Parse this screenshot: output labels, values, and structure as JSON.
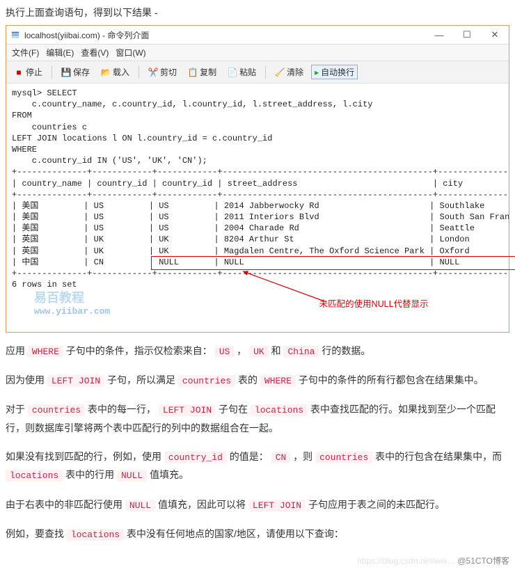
{
  "intro": "执行上面查询语句，得到以下结果 -",
  "window": {
    "title": "localhost(yiibai.com) - 命令列介面",
    "controls": {
      "min": "—",
      "max": "☐",
      "close": "✕"
    }
  },
  "menubar": {
    "file": "文件(F)",
    "edit": "编辑(E)",
    "view": "查看(V)",
    "window": "窗口(W)"
  },
  "toolbar": {
    "stop": "停止",
    "save": "保存",
    "load": "载入",
    "cut": "剪切",
    "copy": "复制",
    "paste": "粘贴",
    "clear": "清除",
    "autoexec": "自动换行"
  },
  "sql": {
    "line1": "mysql> SELECT",
    "line2": "    c.country_name, c.country_id, l.country_id, l.street_address, l.city",
    "line3": "FROM",
    "line4": "    countries c",
    "line5": "LEFT JOIN locations l ON l.country_id = c.country_id",
    "line6": "WHERE",
    "line7": "    c.country_id IN ('US', 'UK', 'CN');"
  },
  "table_header": {
    "country_name": "country_name",
    "country_id1": "country_id",
    "country_id2": "country_id",
    "street_address": "street_address",
    "city": "city"
  },
  "rows": [
    {
      "cn": "美国",
      "cid1": "US",
      "cid2": "US",
      "street": "2014 Jabberwocky Rd",
      "city": "Southlake"
    },
    {
      "cn": "美国",
      "cid1": "US",
      "cid2": "US",
      "street": "2011 Interiors Blvd",
      "city": "South San Francisco"
    },
    {
      "cn": "美国",
      "cid1": "US",
      "cid2": "US",
      "street": "2004 Charade Rd",
      "city": "Seattle"
    },
    {
      "cn": "英国",
      "cid1": "UK",
      "cid2": "UK",
      "street": "8204 Arthur St",
      "city": "London"
    },
    {
      "cn": "英国",
      "cid1": "UK",
      "cid2": "UK",
      "street": "Magdalen Centre, The Oxford Science Park",
      "city": "Oxford"
    },
    {
      "cn": "中国",
      "cid1": "CN",
      "cid2": "NULL",
      "street": "NULL",
      "city": "NULL"
    }
  ],
  "rows_summary": "6 rows in set",
  "watermark": {
    "l1": "易百教程",
    "l2": "www.yiibar.com"
  },
  "callout": "未匹配的使用NULL代替显示",
  "para1": {
    "t1": "应用 ",
    "kw1": "WHERE",
    "t2": " 子句中的条件，指示仅检索来自： ",
    "kw2": "US",
    "t3": " ， ",
    "kw3": "UK",
    "t4": " 和 ",
    "kw4": "China",
    "t5": " 行的数据。"
  },
  "para2": {
    "t1": "因为使用 ",
    "kw1": "LEFT JOIN",
    "t2": " 子句，所以满足 ",
    "kw2": "countries",
    "t3": " 表的 ",
    "kw3": "WHERE",
    "t4": " 子句中的条件的所有行都包含在结果集中。"
  },
  "para3": {
    "t1": "对于 ",
    "kw1": "countries",
    "t2": " 表中的每一行， ",
    "kw2": "LEFT JOIN",
    "t3": " 子句在 ",
    "kw3": "locations",
    "t4": " 表中查找匹配的行。如果找到至少一个匹配行，则数据库引擎将两个表中匹配行的列中的数据组合在一起。"
  },
  "para4": {
    "t1": "如果没有找到匹配的行，例如，使用 ",
    "kw1": "country_id",
    "t2": " 的值是： ",
    "kw2": "CN",
    "t3": " ，则 ",
    "kw3": "countries",
    "t4": " 表中的行包含在结果集中，而 ",
    "kw4": "locations",
    "t5": " 表中的行用 ",
    "kw5": "NULL",
    "t6": " 值填充。"
  },
  "para5": {
    "t1": "由于右表中的非匹配行使用 ",
    "kw1": "NULL",
    "t2": " 值填充，因此可以将 ",
    "kw2": "LEFT JOIN",
    "t3": " 子句应用于表之间的未匹配行。"
  },
  "para6": {
    "t1": "例如，要查找 ",
    "kw1": "locations",
    "t2": " 表中没有任何地点的国家/地区，请使用以下查询："
  },
  "footer": {
    "faint": "https://blog.csdn.net/wei…",
    "dark": "@51CTO博客"
  }
}
